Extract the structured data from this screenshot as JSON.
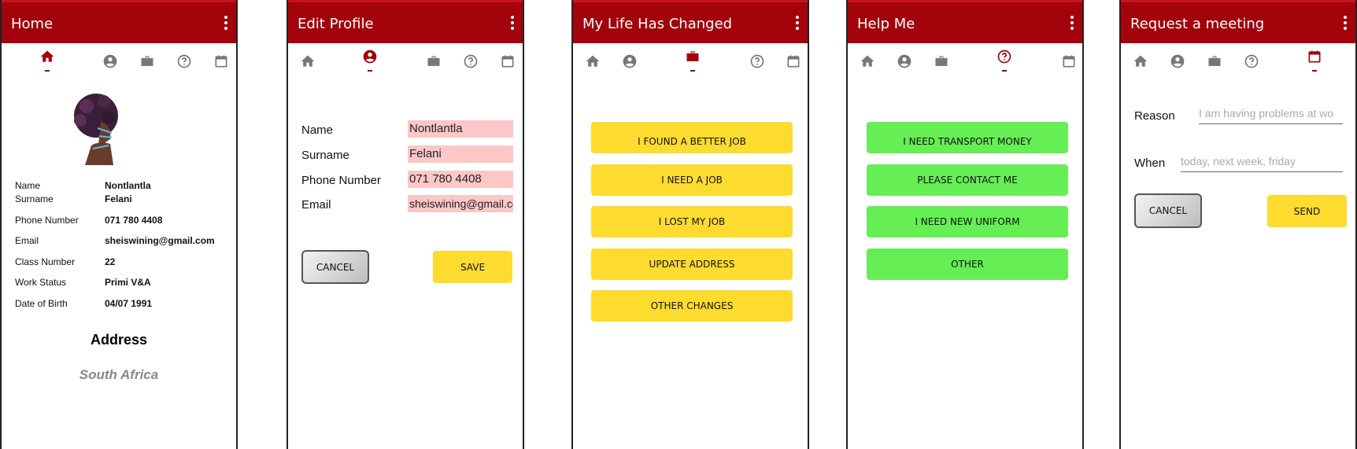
{
  "colors": {
    "appbar": "#a3030b",
    "active_icon": "#a3030b",
    "inactive_icon": "#777777",
    "yellow_button": "#fddb2f",
    "green_button": "#66ee55",
    "field_bg": "#fcc7c7"
  },
  "nav_icons": [
    "home-icon",
    "account-circle-icon",
    "briefcase-icon",
    "help-circle-icon",
    "calendar-icon"
  ],
  "screens": {
    "home": {
      "title": "Home",
      "profile": {
        "name_label": "Name",
        "name_value": "Nontlantla",
        "surname_label": "Surname",
        "surname_value": "Felani",
        "phone_label": "Phone Number",
        "phone_value": "071 780 4408",
        "email_label": "Email",
        "email_value": "sheiswining@gmail.com",
        "class_label": "Class Number",
        "class_value": "22",
        "work_label": "Work Status",
        "work_value": "Primi V&A",
        "dob_label": "Date of Birth",
        "dob_value": "04/07 1991"
      },
      "address_heading": "Address",
      "address_value": "South Africa"
    },
    "edit_profile": {
      "title": "Edit Profile",
      "name_label": "Name",
      "name_value": "Nontlantla",
      "surname_label": "Surname",
      "surname_value": "Felani",
      "phone_label": "Phone Number",
      "phone_value": "071 780 4408",
      "email_label": "Email",
      "email_value": "sheiswining@gmail.co",
      "cancel_label": "CANCEL",
      "save_label": "SAVE"
    },
    "life_changed": {
      "title": "My Life Has Changed",
      "options": [
        "I FOUND A BETTER JOB",
        "I NEED A JOB",
        "I LOST MY JOB",
        "UPDATE ADDRESS",
        "OTHER CHANGES"
      ]
    },
    "help_me": {
      "title": "Help Me",
      "options": [
        "I NEED TRANSPORT MONEY",
        "PLEASE CONTACT ME",
        "I NEED NEW UNIFORM",
        "OTHER"
      ]
    },
    "meeting": {
      "title": "Request a meeting",
      "reason_label": "Reason",
      "reason_placeholder": "I am having problems at wo",
      "when_label": "When",
      "when_placeholder": "today, next week, friday",
      "cancel_label": "CANCEL",
      "send_label": "SEND"
    }
  }
}
